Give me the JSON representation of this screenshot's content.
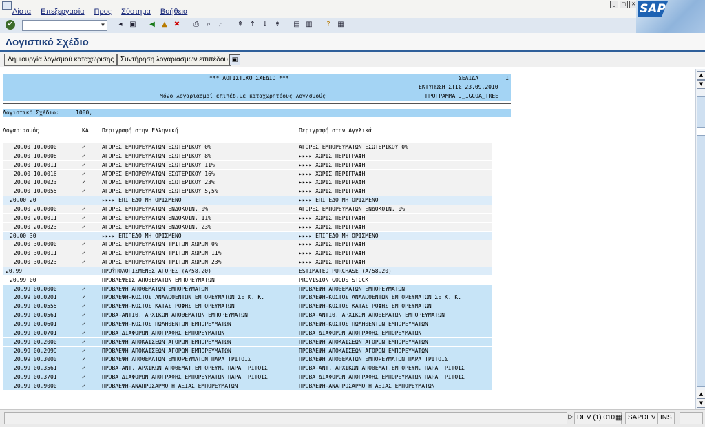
{
  "menu": [
    "Λίστα",
    "Επεξεργασία",
    "Προς",
    "Σύστημα",
    "Βοήθεια"
  ],
  "logo_text": "SAP",
  "page_title": "Λογιστικό Σχέδιο",
  "buttons": {
    "create": "Δημιουργία λογ/σμού καταχώρισης",
    "maintain": "Συντήρηση λογαριασμών επιπέδου"
  },
  "report_header": {
    "title": "*** ΛΟΓΙΣΤΙΚΟ ΣΧΕΔΙΟ ***",
    "page_label": "ΣΕΛΙΔΑ",
    "page_value": "1",
    "print_date": "ΕΚΤΥΠΩΣΗ ΣΤΙΣ 23.09.2010",
    "subtitle": "Μόνο λογαριασμοί επιπέδ.με καταχωρητέους λογ/σμούς",
    "program": "ΠΡΟΓΡΑΜΜΑ J_1GCOA_TREE",
    "chart_label": "Λογιστικό Σχέδιο:",
    "chart_value": "1000,"
  },
  "columns": {
    "account": "Λογαριασμός",
    "ka": "ΚΑ",
    "desc_greek": "Περιγραφή στην Ελληνική",
    "desc_english": "Περιγραφή στην Αγγλικά"
  },
  "rows": [
    {
      "account": "20.00.10.0000",
      "ka": "✓",
      "greek": "ΑΓΟΡΕΣ ΕΜΠΟΡΕΥΜΑΤΩΝ ΕΣΩΤΕΡΙΚΟΥ 0%",
      "english": "ΑΓΟΡΕΣ ΕΜΠΟΡΕΥΜΑΤΩΝ ΕΣΩΤΕΡΙΚΟΥ 0%",
      "type": "item"
    },
    {
      "account": "20.00.10.0008",
      "ka": "✓",
      "greek": "ΑΓΟΡΕΣ ΕΜΠΟΡΕΥΜΑΤΩΝ ΕΣΩΤΕΡΙΚΟΥ 8%",
      "english": "▸▸▸▸ ΧΩΡΙΣ ΠΕΡΙΓΡΑΦΗ",
      "type": "item"
    },
    {
      "account": "20.00.10.0011",
      "ka": "✓",
      "greek": "ΑΓΟΡΕΣ ΕΜΠΟΡΕΥΜΑΤΩΝ ΕΣΩΤΕΡΙΚΟΥ 11%",
      "english": "▸▸▸▸ ΧΩΡΙΣ ΠΕΡΙΓΡΑΦΗ",
      "type": "item"
    },
    {
      "account": "20.00.10.0016",
      "ka": "✓",
      "greek": "ΑΓΟΡΕΣ ΕΜΠΟΡΕΥΜΑΤΩΝ ΕΣΩΤΕΡΙΚΟΥ 16%",
      "english": "▸▸▸▸ ΧΩΡΙΣ ΠΕΡΙΓΡΑΦΗ",
      "type": "item"
    },
    {
      "account": "20.00.10.0023",
      "ka": "✓",
      "greek": "ΑΓΟΡΕΣ ΕΜΠΟΡΕΥΜΑΤΩΝ ΕΣΩΤΕΡΙΚΟΥ 23%",
      "english": "▸▸▸▸ ΧΩΡΙΣ ΠΕΡΙΓΡΑΦΗ",
      "type": "item"
    },
    {
      "account": "20.00.10.0055",
      "ka": "✓",
      "greek": "ΑΓΟΡΕΣ ΕΜΠΟΡΕΥΜΑΤΩΝ ΕΣΩΤΕΡΙΚΟΥ 5,5%",
      "english": "▸▸▸▸ ΧΩΡΙΣ ΠΕΡΙΓΡΑΦΗ",
      "type": "item"
    },
    {
      "account": "20.00.20",
      "ka": "",
      "greek": "▸▸▸▸ ΕΠΙΠΕΔΟ ΜΗ ΟΡΙΣΜΕΝΟ",
      "english": "▸▸▸▸ ΕΠΙΠΕΔΟ ΜΗ ΟΡΙΣΜΕΝΟ",
      "type": "lvl"
    },
    {
      "account": "20.00.20.0000",
      "ka": "✓",
      "greek": "ΑΓΟΡΕΣ ΕΜΠΟΡΕΥΜΑΤΩΝ ΕΝΔΟΚΟΙΝ. 0%",
      "english": "ΑΓΟΡΕΣ ΕΜΠΟΡΕΥΜΑΤΩΝ ΕΝΔΟΚΟΙΝ. 0%",
      "type": "item"
    },
    {
      "account": "20.00.20.0011",
      "ka": "✓",
      "greek": "ΑΓΟΡΕΣ ΕΜΠΟΡΕΥΜΑΤΩΝ ΕΝΔΟΚΟΙΝ. 11%",
      "english": "▸▸▸▸ ΧΩΡΙΣ ΠΕΡΙΓΡΑΦΗ",
      "type": "item"
    },
    {
      "account": "20.00.20.0023",
      "ka": "✓",
      "greek": "ΑΓΟΡΕΣ ΕΜΠΟΡΕΥΜΑΤΩΝ ΕΝΔΟΚΟΙΝ. 23%",
      "english": "▸▸▸▸ ΧΩΡΙΣ ΠΕΡΙΓΡΑΦΗ",
      "type": "item"
    },
    {
      "account": "20.00.30",
      "ka": "",
      "greek": "▸▸▸▸ ΕΠΙΠΕΔΟ ΜΗ ΟΡΙΣΜΕΝΟ",
      "english": "▸▸▸▸ ΕΠΙΠΕΔΟ ΜΗ ΟΡΙΣΜΕΝΟ",
      "type": "lvl"
    },
    {
      "account": "20.00.30.0000",
      "ka": "✓",
      "greek": "ΑΓΟΡΕΣ ΕΜΠΟΡΕΥΜΑΤΩΝ ΤΡΙΤΩΝ ΧΩΡΩΝ 0%",
      "english": "▸▸▸▸ ΧΩΡΙΣ ΠΕΡΙΓΡΑΦΗ",
      "type": "item"
    },
    {
      "account": "20.00.30.0011",
      "ka": "✓",
      "greek": "ΑΓΟΡΕΣ ΕΜΠΟΡΕΥΜΑΤΩΝ ΤΡΙΤΩΝ ΧΩΡΩΝ 11%",
      "english": "▸▸▸▸ ΧΩΡΙΣ ΠΕΡΙΓΡΑΦΗ",
      "type": "item"
    },
    {
      "account": "20.00.30.0023",
      "ka": "✓",
      "greek": "ΑΓΟΡΕΣ ΕΜΠΟΡΕΥΜΑΤΩΝ ΤΡΙΤΩΝ ΧΩΡΩΝ 23%",
      "english": "▸▸▸▸ ΧΩΡΙΣ ΠΕΡΙΓΡΑΦΗ",
      "type": "item"
    },
    {
      "account": "20.99",
      "ka": "",
      "greek": "ΠΡΟΫΠΟΛΟΓΙΣΜΕΝΕΣ ΑΓΟΡΕΣ (Α/58.20)",
      "english": "ESTIMATED PURCHASE (A/58.20)",
      "type": "lvl"
    },
    {
      "account": "20.99.00",
      "ka": "",
      "greek": "ΠΡΟΒΛΕΨΕΙΣ ΑΠΟΘΕΜΑΤΩΝ ΕΜΠΟΡΕΥΜΑΤΩΝ",
      "english": "PROVISION GOODS STOCK",
      "type": "total"
    },
    {
      "account": "20.99.00.0000",
      "ka": "✓",
      "greek": "ΠΡΟΒΛΕΨΗ ΑΠΟΘΕΜΑΤΩΝ ΕΜΠΟΡΕΥΜΑΤΩΝ",
      "english": "ΠΡΟΒΛΕΨΗ ΑΠΟΘΕΜΑΤΩΝ ΕΜΠΟΡΕΥΜΑΤΩΝ",
      "type": "blue"
    },
    {
      "account": "20.99.00.0201",
      "ka": "✓",
      "greek": "ΠΡΟΒΛΕΨΗ-ΚΟΣΤΟΣ ΑΝΑΛΩΘΕΝΤΩΝ ΕΜΠΟΡΕΥΜΑΤΩΝ ΣΕ Κ. Κ.",
      "english": "ΠΡΟΒΛΕΨΗ-ΚΟΣΤΟΣ ΑΝΑΛΩΘΕΝΤΩΝ ΕΜΠΟΡΕΥΜΑΤΩΝ ΣΕ Κ. Κ.",
      "type": "blue"
    },
    {
      "account": "20.99.00.0555",
      "ka": "✓",
      "greek": "ΠΡΟΒΛΕΨΗ-ΚΟΣΤΟΣ ΚΑΤΑΣΤΡΟΦΗΣ ΕΜΠΟΡΕΥΜΑΤΩΝ",
      "english": "ΠΡΟΒΛΕΨΗ-ΚΟΣΤΟΣ ΚΑΤΑΣΤΡΟΦΗΣ ΕΜΠΟΡΕΥΜΑΤΩΝ",
      "type": "blue"
    },
    {
      "account": "20.99.00.0561",
      "ka": "✓",
      "greek": "ΠΡΟΒΑ-ΑΝΤΙΘ. ΑΡΧΙΚΩΝ ΑΠΟΘΕΜΑΤΩΝ ΕΜΠΟΡΕΥΜΑΤΩΝ",
      "english": "ΠΡΟΒΑ-ΑΝΤΙΘ. ΑΡΧΙΚΩΝ ΑΠΟΘΕΜΑΤΩΝ ΕΜΠΟΡΕΥΜΑΤΩΝ",
      "type": "blue"
    },
    {
      "account": "20.99.00.0601",
      "ka": "✓",
      "greek": "ΠΡΟΒΛΕΨΗ-ΚΟΣΤΟΣ ΠΩΛΗΘΕΝΤΩΝ ΕΜΠΟΡΕΥΜΑΤΩΝ",
      "english": "ΠΡΟΒΛΕΨΗ-ΚΟΣΤΟΣ ΠΩΛΗΘΕΝΤΩΝ ΕΜΠΟΡΕΥΜΑΤΩΝ",
      "type": "blue"
    },
    {
      "account": "20.99.00.0701",
      "ka": "✓",
      "greek": "ΠΡΟΒΑ.ΔΙΑΦΟΡΩΝ ΑΠΟΓΡΑΦΗΣ ΕΜΠΟΡΕΥΜΑΤΩΝ",
      "english": "ΠΡΟΒΑ.ΔΙΑΦΟΡΩΝ ΑΠΟΓΡΑΦΗΣ ΕΜΠΟΡΕΥΜΑΤΩΝ",
      "type": "blue"
    },
    {
      "account": "20.99.00.2000",
      "ka": "✓",
      "greek": "ΠΡΟΒΛΕΨΗ ΑΠΟΚΑΙΣΕΩΝ ΑΓΟΡΩΝ ΕΜΠΟΡΕΥΜΑΤΩΝ",
      "english": "ΠΡΟΒΛΕΨΗ ΑΠΟΚΑΙΣΕΩΝ ΑΓΟΡΩΝ ΕΜΠΟΡΕΥΜΑΤΩΝ",
      "type": "blue"
    },
    {
      "account": "20.99.00.2999",
      "ka": "✓",
      "greek": "ΠΡΟΒΛΕΨΗ ΑΠΟΚΑΙΣΕΩΝ ΑΓΟΡΩΝ ΕΜΠΟΡΕΥΜΑΤΩΝ",
      "english": "ΠΡΟΒΛΕΨΗ ΑΠΟΚΑΙΣΕΩΝ ΑΓΟΡΩΝ ΕΜΠΟΡΕΥΜΑΤΩΝ",
      "type": "blue"
    },
    {
      "account": "20.99.00.3000",
      "ka": "✓",
      "greek": "ΠΡΟΒΛΕΨΗ ΑΠΟΘΕΜΑΤΩΝ ΕΜΠΟΡΕΥΜΑΤΩΝ ΠΑΡΑ ΤΡΙΤΟΙΣ",
      "english": "ΠΡΟΒΛΕΨΗ ΑΠΟΘΕΜΑΤΩΝ ΕΜΠΟΡΕΥΜΑΤΩΝ ΠΑΡΑ ΤΡΙΤΟΙΣ",
      "type": "blue"
    },
    {
      "account": "20.99.00.3561",
      "ka": "✓",
      "greek": "ΠΡΟΒΑ-ΑΝΤ. ΑΡΧΙΚΩΝ ΑΠΟΘΕΜΑΤ.ΕΜΠΟΡΕΥΜ. ΠΑΡΑ ΤΡΙΤΟΙΣ",
      "english": "ΠΡΟΒΑ-ΑΝΤ. ΑΡΧΙΚΩΝ ΑΠΟΘΕΜΑΤ.ΕΜΠΟΡΕΥΜ. ΠΑΡΑ ΤΡΙΤΟΙΣ",
      "type": "blue"
    },
    {
      "account": "20.99.00.3701",
      "ka": "✓",
      "greek": "ΠΡΟΒΑ.ΔΙΑΦΟΡΩΝ ΑΠΟΓΡΑΦΗΣ ΕΜΠΟΡΕΥΜΑΤΩΝ ΠΑΡΑ ΤΡΙΤΟΙΣ",
      "english": "ΠΡΟΒΑ.ΔΙΑΦΟΡΩΝ ΑΠΟΓΡΑΦΗΣ ΕΜΠΟΡΕΥΜΑΤΩΝ ΠΑΡΑ ΤΡΙΤΟΙΣ",
      "type": "blue"
    },
    {
      "account": "20.99.00.9000",
      "ka": "✓",
      "greek": "ΠΡΟΒΛΕΨΗ-ΑΝΑΠΡΟΣΑΡΜΟΓΗ ΑΞΙΑΣ ΕΜΠΟΡΕΥΜΑΤΩΝ",
      "english": "ΠΡΟΒΛΕΨΗ-ΑΝΑΠΡΟΣΑΡΜΟΓΗ ΑΞΙΑΣ ΕΜΠΟΡΕΥΜΑΤΩΝ",
      "type": "blue"
    }
  ],
  "status": {
    "system": "DEV (1) 010",
    "server": "SAPDEV",
    "mode": "INS"
  },
  "colors": {
    "header_band": "#a4d4f4",
    "title_color": "#1d3f7a",
    "sap_blue": "#1d62b3"
  }
}
